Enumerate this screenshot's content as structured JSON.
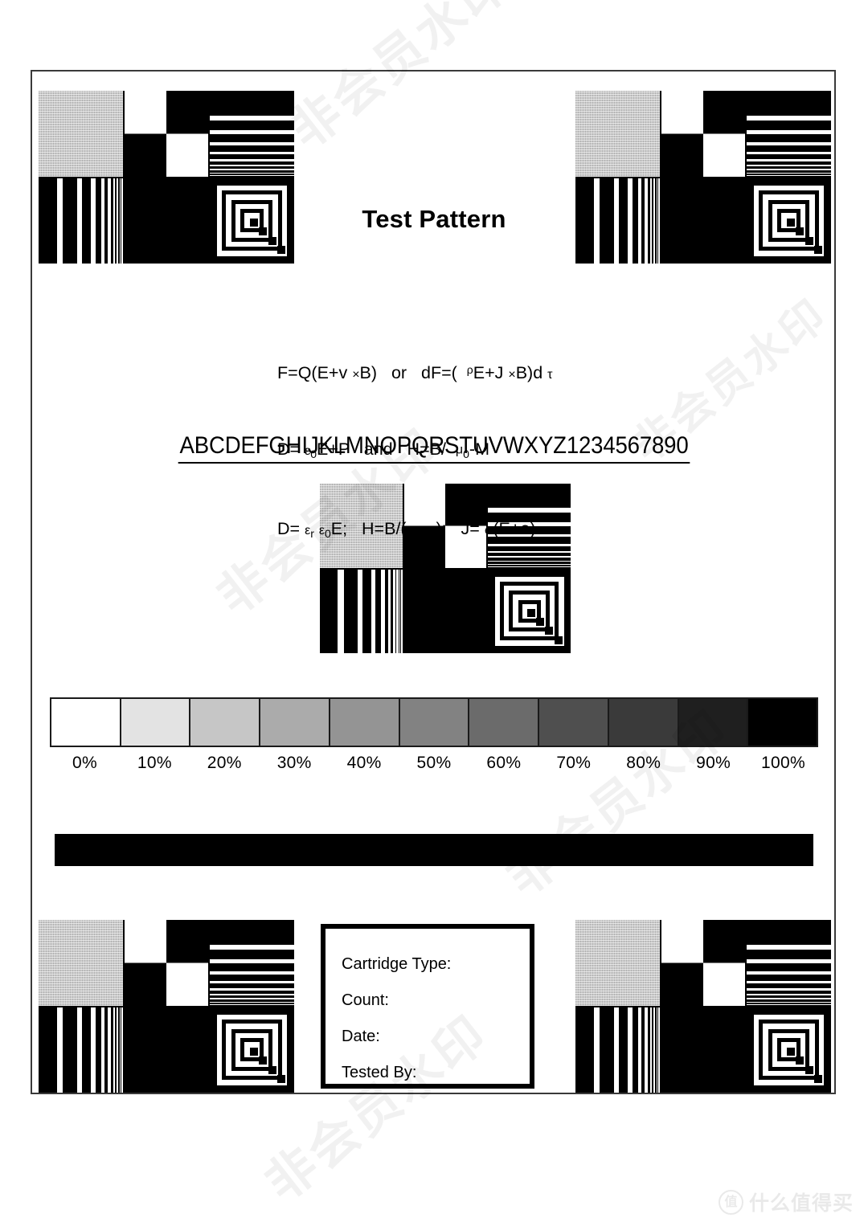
{
  "document": {
    "title": "Test Pattern"
  },
  "formulas": {
    "lines": [
      "F=Q(E+v ×B)    or    dF=(   ᵖE+J ×B)d τ",
      "D= ε₀E+P    and    H=B/   μ₀-M",
      "D= εᵣ ε₀E;    H=B/( μᵣμ₀);    J= σ(E+e)"
    ],
    "line1": "F=Q(E+v ×B)   or   dF=(  ᵖE+J ×B)d τ",
    "line2": "D= ε₀E+P   and   H=B/  μ₀-M",
    "line3": "D= εᵣ ε₀E;   H=B/( μᵣμ₀);   J= σ(E+e)"
  },
  "alphabet": {
    "text": "ABCDEFGHIJKLMNOPQRSTUVWXYZ1234567890"
  },
  "grayscale": {
    "labels": [
      "0%",
      "10%",
      "20%",
      "30%",
      "40%",
      "50%",
      "60%",
      "70%",
      "80%",
      "90%",
      "100%"
    ],
    "colors": [
      "#ffffff",
      "#e3e3e3",
      "#c6c6c6",
      "#ababab",
      "#949494",
      "#828282",
      "#6b6b6b",
      "#4f4f4f",
      "#3a3a3a",
      "#1f1f1f",
      "#000000"
    ],
    "percent_values": [
      0,
      10,
      20,
      30,
      40,
      50,
      60,
      70,
      80,
      90,
      100
    ]
  },
  "cartridge": {
    "fields": [
      {
        "label": "Cartridge Type:",
        "value": ""
      },
      {
        "label": "Count:",
        "value": ""
      },
      {
        "label": "Date:",
        "value": ""
      },
      {
        "label": "Tested By:",
        "value": ""
      }
    ],
    "field_0": "Cartridge Type:",
    "field_1": "Count:",
    "field_2": "Date:",
    "field_3": "Tested By:"
  },
  "pattern_blocks": {
    "cells": [
      "halftone-gray",
      "checkerboard",
      "horizontal-line-wedge",
      "vertical-line-wedge",
      "solid-black",
      "concentric-squares"
    ],
    "count": 5,
    "positions": [
      "top-left",
      "top-right",
      "center",
      "bottom-left",
      "bottom-right"
    ]
  },
  "watermark": {
    "diagonal_text": "非会员水印",
    "logo_badge": "值",
    "logo_text": "什么值得买"
  },
  "colors": {
    "ink": "#000000",
    "frame": "#3a3a3a",
    "halftone": "#c9c9c9",
    "paper": "#ffffff"
  }
}
